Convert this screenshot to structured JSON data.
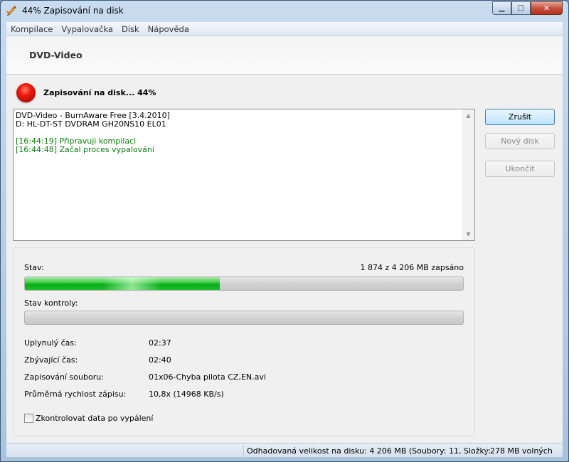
{
  "window": {
    "title": "44% Zapisování na disk",
    "minimize_label": "▁",
    "maximize_label": "□",
    "close_label": "✕"
  },
  "menu": [
    "Kompilace",
    "Vypalovačka",
    "Disk",
    "Nápověda"
  ],
  "header": {
    "title": "DVD-Video"
  },
  "status": {
    "text": "Zapisování na disk... 44%"
  },
  "log": {
    "lines": [
      "DVD-Video - BurnAware Free [3.4.2010]",
      "D: HL-DT-ST DVDRAM GH20NS10 EL01"
    ],
    "events": [
      "[16:44:19] Připravuji kompilaci",
      "[16:44:48] Začal proces vypalování"
    ]
  },
  "buttons": {
    "cancel": "Zrušit",
    "new_disc": "Nový disk",
    "quit": "Ukončit"
  },
  "progress": {
    "state_label": "Stav:",
    "written_text": "1 874 z 4 206 MB zapsáno",
    "write_fraction": 0.445,
    "verify_label": "Stav kontroly:",
    "verify_fraction": 0
  },
  "info": [
    {
      "label": "Uplynulý čas:",
      "value": "02:37"
    },
    {
      "label": "Zbývající čas:",
      "value": "02:40"
    },
    {
      "label": "Zapisování souboru:",
      "value": "01x06-Chyba pilota CZ,EN.avi"
    },
    {
      "label": "Průměrná rychlost zápisu:",
      "value": "10,8x (14968 KB/s)"
    }
  ],
  "verify_checkbox": {
    "label": "Zkontrolovat data po vypálení",
    "checked": false
  },
  "statusbar": {
    "estimate": "Odhadovaná velikost na disku: 4 206 MB (Soubory: 11, Složky:",
    "free": "278 MB volných"
  },
  "colors": {
    "progress_green": "#1ab52a",
    "log_event_green": "#0b7c0b",
    "status_orb_red": "#e01408"
  }
}
